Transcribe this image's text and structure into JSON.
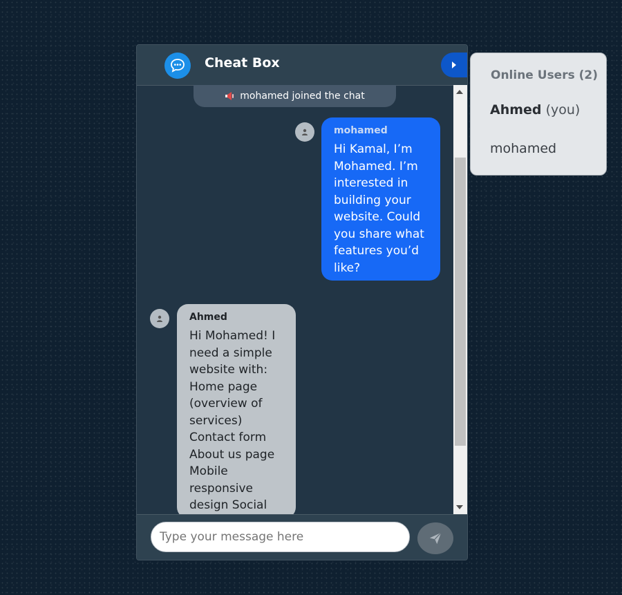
{
  "header": {
    "title": "Cheat Box",
    "logo_icon": "chat-bubbles-icon",
    "toggle_icon": "caret-right-icon"
  },
  "system_message": {
    "icon": "megaphone-icon",
    "text": "mohamed joined the chat"
  },
  "messages": [
    {
      "direction": "outgoing",
      "sender": "mohamed",
      "text": "Hi Kamal, I’m Mohamed. I’m interested in building your website. Could you share what features you’d like?"
    },
    {
      "direction": "incoming",
      "sender": "Ahmed",
      "text": "Hi Mohamed! I need a simple website with: Home page (overview of services) Contact form About us page Mobile responsive design Social media links"
    }
  ],
  "composer": {
    "placeholder": "Type your message here",
    "send_icon": "paper-plane-icon"
  },
  "online_users": {
    "title": "Online Users (2)",
    "users": [
      {
        "name": "Ahmed",
        "suffix": "(you)"
      },
      {
        "name": "mohamed",
        "suffix": ""
      }
    ]
  },
  "colors": {
    "accent": "#1769f6",
    "toggle": "#0d57c9",
    "logo": "#1c8fe8",
    "incoming_bubble": "#bec4c9"
  }
}
